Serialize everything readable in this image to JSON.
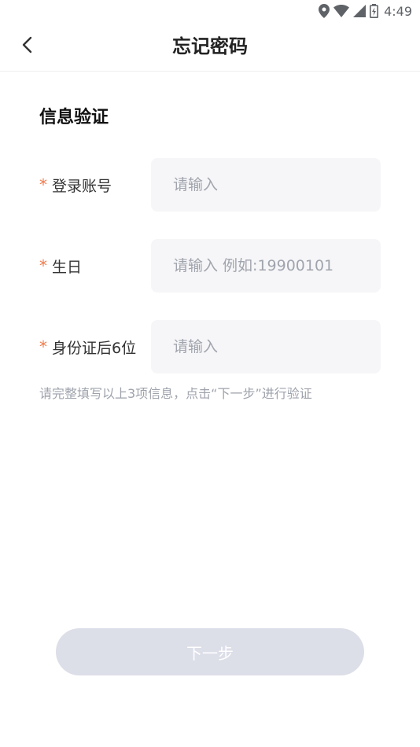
{
  "status_bar": {
    "time": "4:49",
    "icons": [
      "location-icon",
      "wifi-icon",
      "signal-icon",
      "battery-icon"
    ]
  },
  "header": {
    "title": "忘记密码",
    "back_icon": "chevron-left-icon"
  },
  "section": {
    "title": "信息验证"
  },
  "form": {
    "required_mark": "*",
    "fields": [
      {
        "label": "登录账号",
        "placeholder": "请输入",
        "value": ""
      },
      {
        "label": "生日",
        "placeholder": "请输入 例如:19900101",
        "value": ""
      },
      {
        "label": "身份证后6位",
        "placeholder": "请输入",
        "value": ""
      }
    ],
    "hint": "请完整填写以上3项信息，点击“下一步”进行验证"
  },
  "actions": {
    "next_label": "下一步",
    "next_enabled": false
  },
  "colors": {
    "accent_required": "#f07b4b",
    "button_disabled": "#dcdee8",
    "input_bg": "#f6f6f8"
  }
}
